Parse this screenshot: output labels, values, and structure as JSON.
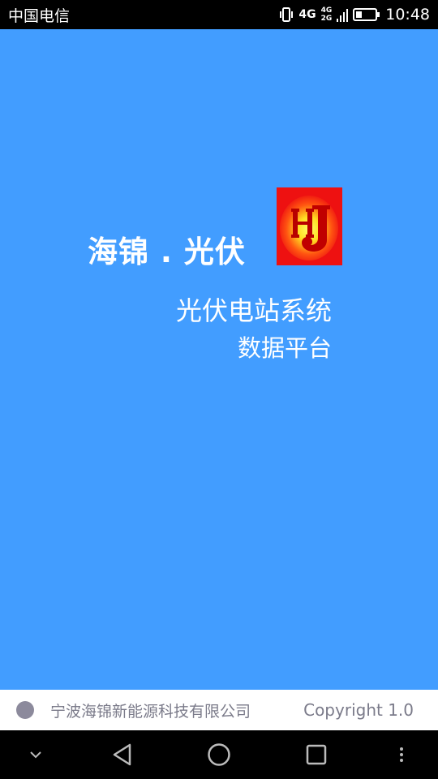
{
  "status_bar": {
    "carrier": "中国电信",
    "network_primary": "4G",
    "network_secondary_top": "4G",
    "network_secondary_bottom": "2G",
    "time": "10:48",
    "icons": [
      "vibrate-icon",
      "signal-icon",
      "battery-icon"
    ]
  },
  "splash": {
    "brand_title": "海锦 . 光伏",
    "system_title": "光伏电站系统",
    "platform_title": "数据平台",
    "logo": {
      "letters": "HJ",
      "background_color": "#ee1111",
      "glow_color": "#ffee33"
    },
    "background_color": "#429dff"
  },
  "footer": {
    "company_name": "宁波海锦新能源科技有限公司",
    "copyright": "Copyright 1.0",
    "dot_color": "#8c8a9c"
  },
  "nav_bar": {
    "buttons": [
      "chevron-down-icon",
      "back-icon",
      "home-icon",
      "recents-icon",
      "more-icon"
    ]
  }
}
